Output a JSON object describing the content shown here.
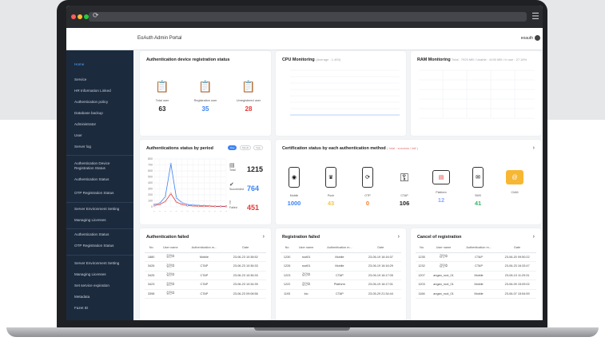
{
  "header": {
    "title": "EoAuth Admin Portal",
    "user": "eoauth"
  },
  "sidebar": {
    "items": [
      "Home",
      "Service",
      "HR Information Linked",
      "Authentication policy",
      "Database backup",
      "Administrator",
      "User",
      "Server log",
      "Authentication Device Registration Status",
      "Authentication Status",
      "OTP Registration Status",
      "Server Environment Setting",
      "Managing Licenses",
      "Authentication Status",
      "OTP Registration Status",
      "Server Environment Setting",
      "Managing Licenses",
      "Set service expiration",
      "Metadata",
      "Fazet ID"
    ]
  },
  "device_reg": {
    "title": "Authentication device registration status",
    "items": [
      {
        "label": "Total user",
        "value": "63",
        "color": "#222222"
      },
      {
        "label": "Registration user",
        "value": "35",
        "color": "#3b82f6"
      },
      {
        "label": "Unregistered user",
        "value": "28",
        "color": "#e53935"
      }
    ]
  },
  "cpu": {
    "title": "CPU Monitoring",
    "sub": "(Average : 1.493)"
  },
  "ram": {
    "title": "RAM Monitoring",
    "sub": "Total : 7920 MB / Usable : 4190 MB / In use : 27.16%"
  },
  "period": {
    "title": "Authentications status by period",
    "tabs": [
      "Day",
      "Month",
      "Year"
    ],
    "stats": [
      {
        "label": "Total",
        "value": "1215",
        "color": "#222222"
      },
      {
        "label": "Succeeded",
        "value": "764",
        "color": "#3b82f6"
      },
      {
        "label": "Failed",
        "value": "451",
        "color": "#e53935"
      }
    ]
  },
  "chart_data": {
    "type": "line",
    "x": [
      "1",
      "2",
      "3",
      "4",
      "5",
      "6",
      "7",
      "8",
      "9",
      "10",
      "11",
      "12",
      "13",
      "14"
    ],
    "series": [
      {
        "values": [
          40,
          60,
          170,
          720,
          150,
          70,
          40,
          30,
          25,
          20,
          15,
          10,
          10,
          10
        ],
        "color": "#3b82f6"
      },
      {
        "values": [
          20,
          40,
          90,
          220,
          80,
          40,
          20,
          15,
          10,
          10,
          10,
          5,
          5,
          5
        ],
        "color": "#e53935"
      }
    ],
    "ylim": [
      0,
      800
    ],
    "yticks": [
      "800",
      "700",
      "600",
      "500",
      "400",
      "300",
      "200",
      "100",
      "0"
    ],
    "grid": true
  },
  "method": {
    "title": "Certification status by each authentication method",
    "sub": "( total : success / fail )",
    "items": [
      {
        "label": "Mobile",
        "value": "1000",
        "color": "#3b82f6",
        "icon": "fingerprint-icon"
      },
      {
        "label": "Push",
        "value": "43",
        "color": "#f5c542",
        "icon": "push-icon"
      },
      {
        "label": "OTP",
        "value": "0",
        "color": "#ff7a29",
        "icon": "otp-icon"
      },
      {
        "label": "CTAP",
        "value": "106",
        "color": "#222222",
        "icon": "key-icon"
      },
      {
        "label": "Platform",
        "value": "12",
        "color": "#8fa8ff",
        "icon": "platform-icon"
      },
      {
        "label": "SMS",
        "value": "41",
        "color": "#3bb36b",
        "icon": "sms-icon"
      },
      {
        "label": "CIAM",
        "value": "",
        "color": "#222222",
        "icon": "email-icon"
      }
    ]
  },
  "auth_failed": {
    "title": "Authentication failed",
    "columns": [
      "No",
      "User name",
      "Authentication m...",
      "Date"
    ],
    "rows": [
      [
        "1880",
        "김민호",
        "Mobile",
        "23-06-23 10:38:52"
      ],
      [
        "3426",
        "김민호",
        "CTAP",
        "23-06-23 10:36:33"
      ],
      [
        "3425",
        "김민호",
        "CTAP",
        "23-06-23 10:36:33"
      ],
      [
        "3423",
        "김민호",
        "CTAP",
        "23-06-23 10:34:39"
      ],
      [
        "3398",
        "김민호",
        "CTAP",
        "23-06-23 09:08:56"
      ]
    ]
  },
  "reg_failed": {
    "title": "Registration failed",
    "columns": [
      "No",
      "User name",
      "Authentication m...",
      "Date"
    ],
    "rows": [
      [
        "1230",
        "root01",
        "Mobile",
        "23-06-19 16:16:37"
      ],
      [
        "1226",
        "root01",
        "Mobile",
        "23-06-19 16:16:29"
      ],
      [
        "1223",
        "김민호",
        "CTAP",
        "23-06-19 16:17:05"
      ],
      [
        "1222",
        "김민호",
        "Platform",
        "23-06-19 16:17:01"
      ],
      [
        "1193",
        "kio",
        "CTAP",
        "23-05-29 21:34:44"
      ]
    ]
  },
  "cancel_reg": {
    "title": "Cancel of registration",
    "columns": [
      "No",
      "User name",
      "Authentication m...",
      "Date"
    ],
    "rows": [
      [
        "1235",
        "김민호",
        "CTAP",
        "23-06-20 09:50:22"
      ],
      [
        "1232",
        "김민호",
        "CTAP",
        "23-06-23 16:33:47"
      ],
      [
        "1207",
        "angan_root_01",
        "Mobile",
        "23-06-10 11:29:31"
      ],
      [
        "1203",
        "angan_root_01",
        "Mobile",
        "23-06-09 15:09:02"
      ],
      [
        "1166",
        "angan_root_01",
        "Mobile",
        "23-06-07 15:54:59"
      ]
    ]
  }
}
